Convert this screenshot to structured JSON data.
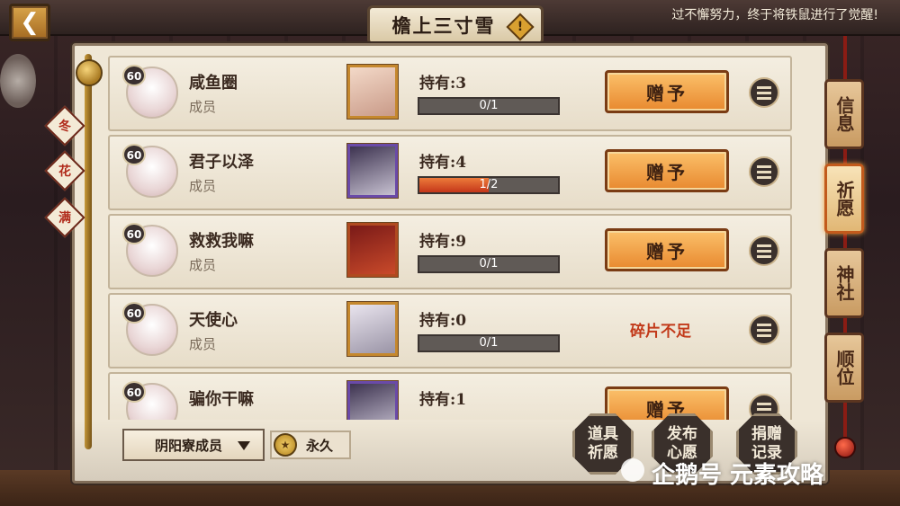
{
  "header": {
    "back_icon": "back-arrow-icon",
    "title": "檐上三寸雪",
    "warn_symbol": "!",
    "notice": "过不懈努力，终于将铁鼠进行了觉醒!"
  },
  "left_tags": [
    {
      "label": "冬"
    },
    {
      "label": "花"
    },
    {
      "label": "满"
    }
  ],
  "rows": [
    {
      "level": "60",
      "name": "咸鱼圈",
      "role": "成员",
      "card_style": "warm",
      "hold": "持有:3",
      "progress_text": "0/1",
      "progress": 0,
      "action": "赠予",
      "action_type": "button"
    },
    {
      "level": "60",
      "name": "君子以泽",
      "role": "成员",
      "card_style": "purple",
      "hold": "持有:4",
      "progress_text": "1/2",
      "progress": 0.5,
      "action": "赠予",
      "action_type": "button"
    },
    {
      "level": "60",
      "name": "救救我嘛",
      "role": "成员",
      "card_style": "red",
      "hold": "持有:9",
      "progress_text": "0/1",
      "progress": 0,
      "action": "赠予",
      "action_type": "button"
    },
    {
      "level": "60",
      "name": "天使心",
      "role": "成员",
      "card_style": "silver",
      "hold": "持有:0",
      "progress_text": "0/1",
      "progress": 0,
      "action": "碎片不足",
      "action_type": "text"
    },
    {
      "level": "60",
      "name": "骗你干嘛",
      "role": "",
      "card_style": "purple",
      "hold": "持有:1",
      "progress_text": "",
      "progress": 0,
      "action": "赠予",
      "action_type": "button"
    }
  ],
  "side_tabs": [
    {
      "label": "信息",
      "active": false
    },
    {
      "label": "祈愿",
      "active": true
    },
    {
      "label": "神社",
      "active": false
    },
    {
      "label": "顺位",
      "active": false
    }
  ],
  "bottom": {
    "filter_value": "阴阳寮成员",
    "duration_label": "永久",
    "buttons": [
      {
        "label": "道具祈愿"
      },
      {
        "label": "发布心愿"
      },
      {
        "label": "捐赠记录"
      }
    ]
  },
  "watermark": "企鹅号 元素攻略",
  "colors": {
    "accent": "#e8892f",
    "insufficient": "#c23a1a",
    "panel": "#efe7d6"
  }
}
